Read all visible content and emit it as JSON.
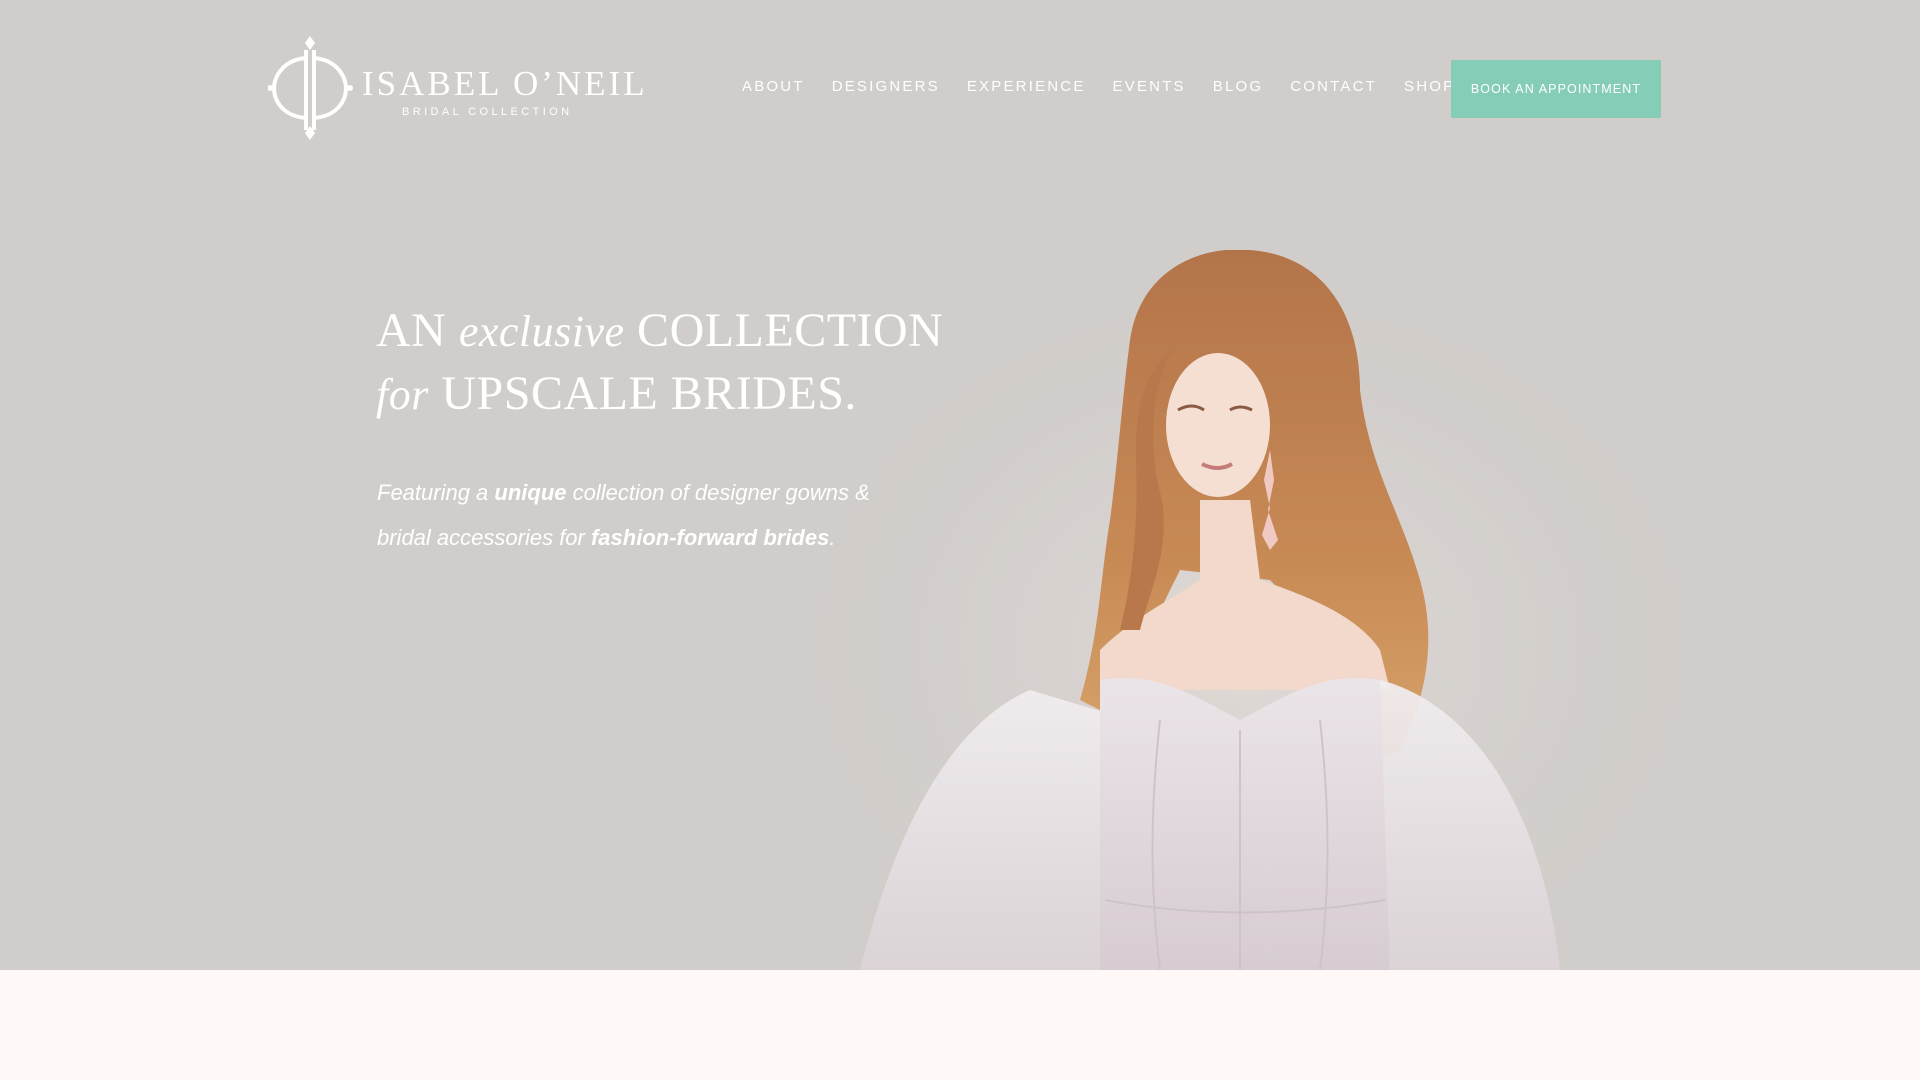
{
  "brand": {
    "name": "ISABEL O’NEIL",
    "subtitle": "BRIDAL COLLECTION"
  },
  "nav": {
    "items": [
      {
        "label": "ABOUT"
      },
      {
        "label": "DESIGNERS"
      },
      {
        "label": "EXPERIENCE"
      },
      {
        "label": "EVENTS"
      },
      {
        "label": "BLOG"
      },
      {
        "label": "CONTACT"
      },
      {
        "label": "SHOP"
      }
    ],
    "cta_label": "BOOK AN APPOINTMENT"
  },
  "hero": {
    "headline": {
      "line1_a": "AN",
      "line1_b": "exclusive",
      "line1_c": "COLLECTION",
      "line2_a": "for",
      "line2_b": "UPSCALE BRIDES."
    },
    "sub": {
      "p1": "Featuring a ",
      "p2": "unique",
      "p3": " collection of designer gowns & bridal accessories for ",
      "p4": "fashion-forward brides",
      "p5": "."
    },
    "image_alt": "Bride with long auburn hair wearing an off-shoulder embellished gown"
  },
  "colors": {
    "hero_bg": "#d1cdca",
    "cta_bg": "#86cdb8",
    "page_bg": "#fef9f6",
    "text": "#ffffff"
  }
}
